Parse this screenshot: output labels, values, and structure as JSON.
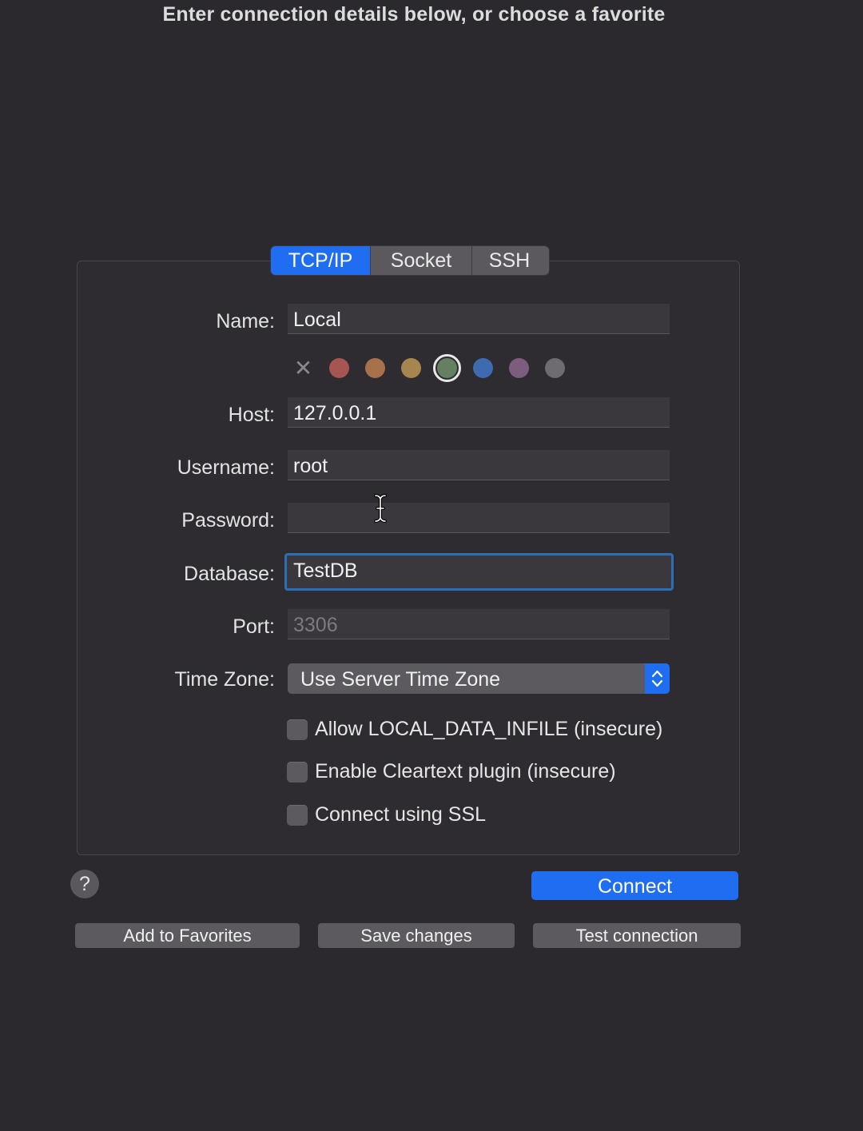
{
  "heading": "Enter connection details below, or choose a favorite",
  "tabs": [
    {
      "label": "TCP/IP",
      "active": true
    },
    {
      "label": "Socket",
      "active": false
    },
    {
      "label": "SSH",
      "active": false
    }
  ],
  "fields": {
    "name": {
      "label": "Name:",
      "value": "Local"
    },
    "host": {
      "label": "Host:",
      "value": "127.0.0.1"
    },
    "username": {
      "label": "Username:",
      "value": "root"
    },
    "password": {
      "label": "Password:",
      "value": ""
    },
    "database": {
      "label": "Database:",
      "value": "TestDB"
    },
    "port": {
      "label": "Port:",
      "placeholder": "3306"
    },
    "timezone": {
      "label": "Time Zone:",
      "value": "Use Server Time Zone"
    }
  },
  "color_options": [
    {
      "name": "none-icon",
      "color": "#8a888d"
    },
    {
      "name": "red",
      "color": "#a65553"
    },
    {
      "name": "orange",
      "color": "#a7714c"
    },
    {
      "name": "yellow",
      "color": "#a7854f"
    },
    {
      "name": "green",
      "color": "#648060",
      "selected": true
    },
    {
      "name": "blue",
      "color": "#3e6ab0"
    },
    {
      "name": "purple",
      "color": "#7c5d80"
    },
    {
      "name": "gray",
      "color": "#6e6c71"
    }
  ],
  "checkboxes": [
    {
      "label": "Allow LOCAL_DATA_INFILE (insecure)",
      "checked": false
    },
    {
      "label": "Enable Cleartext plugin (insecure)",
      "checked": false
    },
    {
      "label": "Connect using SSL",
      "checked": false
    }
  ],
  "buttons": {
    "help": "?",
    "connect": "Connect",
    "add_favorites": "Add to Favorites",
    "save_changes": "Save changes",
    "test_connection": "Test connection"
  },
  "colors": {
    "accent": "#1f6df0",
    "focus_ring": "#2a6fb8",
    "background": "#2b292e"
  }
}
